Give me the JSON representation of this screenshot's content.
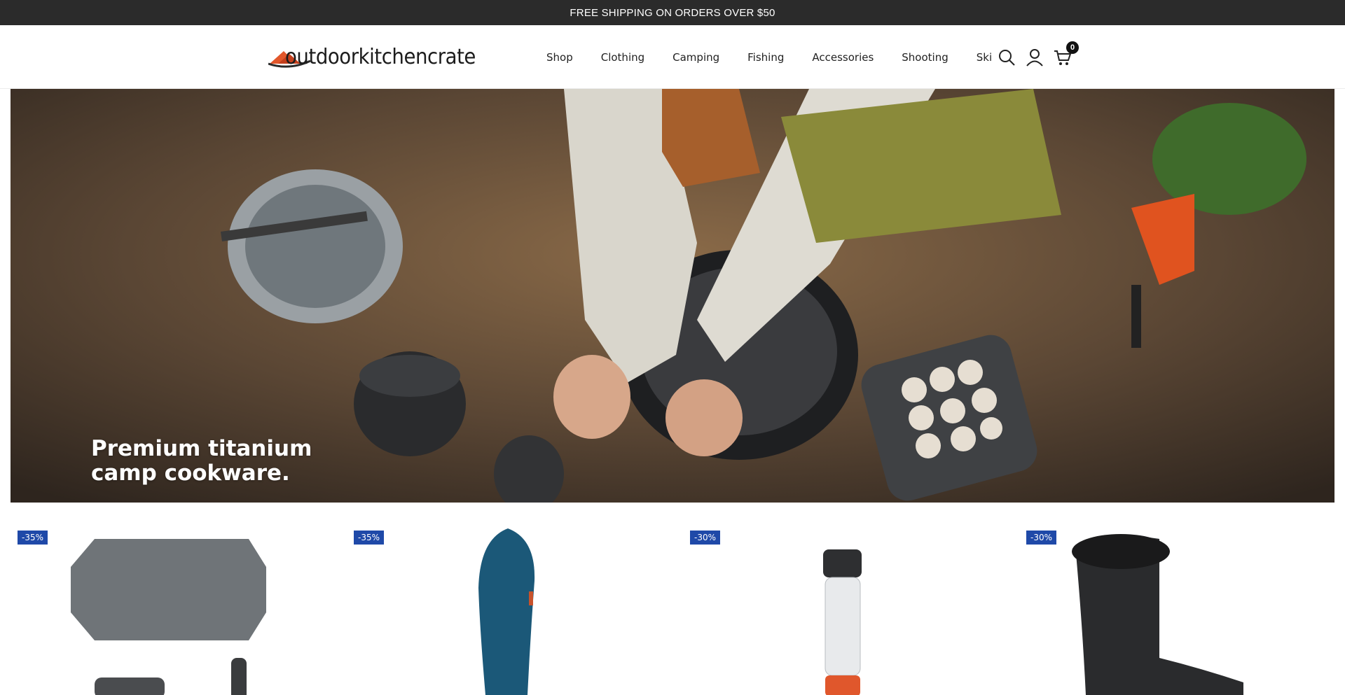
{
  "announcement": {
    "text": "FREE SHIPPING ON ORDERS OVER $50"
  },
  "header": {
    "logo_text": "outdoorkitchencrate",
    "nav": [
      "Shop",
      "Clothing",
      "Camping",
      "Fishing",
      "Accessories",
      "Shooting",
      "Ski"
    ],
    "icons": {
      "search": "search-icon",
      "account": "user-icon",
      "cart": "cart-icon"
    },
    "cart_count": "0"
  },
  "hero": {
    "caption_line1": "Premium titanium",
    "caption_line2": "camp cookware."
  },
  "products": [
    {
      "badge": "-35%",
      "image": "tent-footprint"
    },
    {
      "badge": "-35%",
      "image": "sleeping-bag"
    },
    {
      "badge": "-30%",
      "image": "grinder-bottle"
    },
    {
      "badge": "-30%",
      "image": "winter-boot"
    }
  ],
  "colors": {
    "announcement_bg": "#2b2b2b",
    "badge_bg": "#1f49a8",
    "logo_accent": "#e2572b"
  }
}
